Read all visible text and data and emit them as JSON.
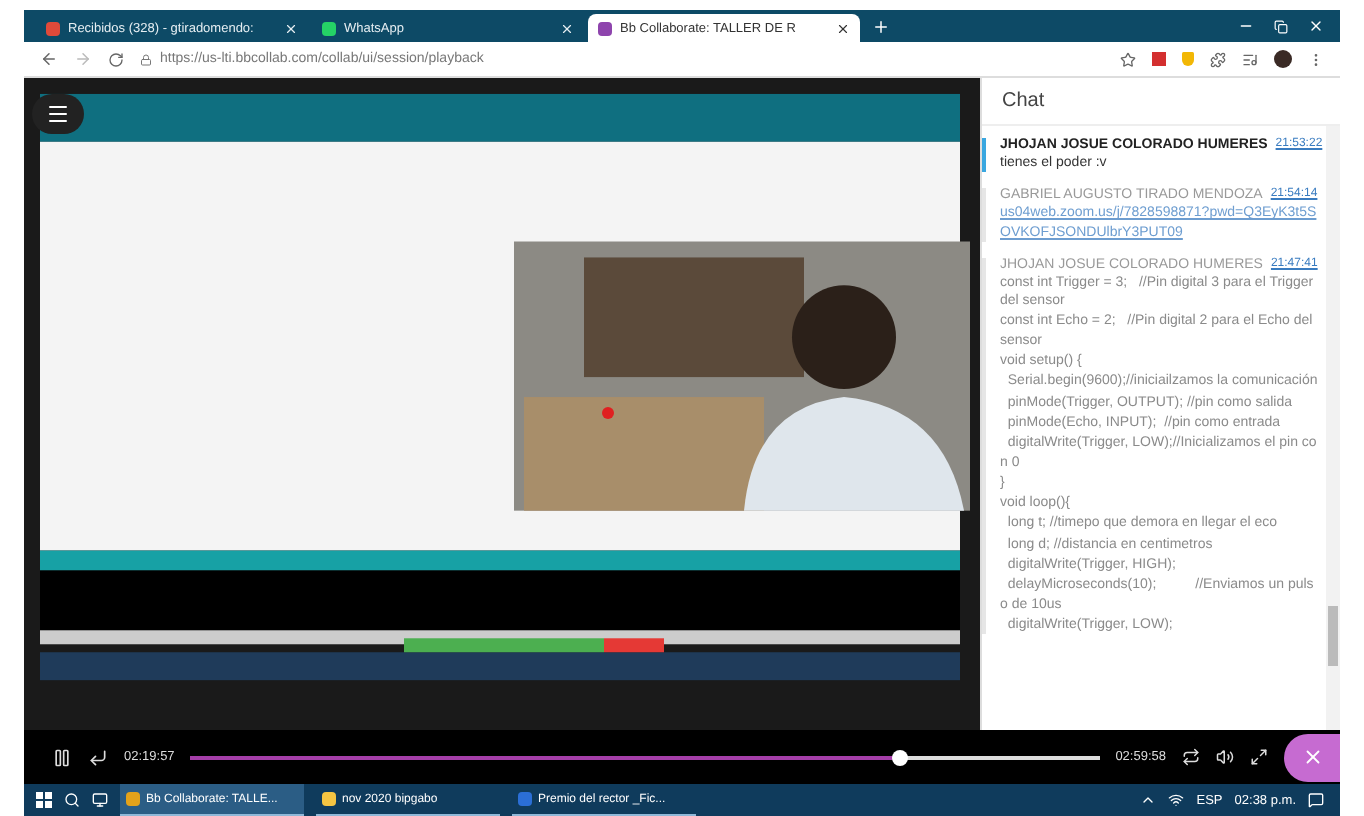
{
  "browser": {
    "tabs": [
      {
        "kind": "mail",
        "title": "Recibidos (328) - gtiradomendo:",
        "selected": false
      },
      {
        "kind": "whatsapp",
        "title": "WhatsApp",
        "selected": false
      },
      {
        "kind": "collab",
        "title": "Bb Collaborate: TALLER DE R",
        "selected": true
      }
    ],
    "address": "https://us-lti.bbcollab.com/collab/ui/session/playback"
  },
  "chat": {
    "title": "Chat",
    "messages": [
      {
        "author": "JHOJAN JOSUE COLORADO HUMERES",
        "time": "21:53:22",
        "highlighted": true,
        "kind": "text",
        "lines": [
          "tienes el poder :v"
        ]
      },
      {
        "author": "GABRIEL AUGUSTO TIRADO MENDOZA",
        "time": "21:54:14",
        "highlighted": false,
        "kind": "link",
        "lines": [
          "us04web.zoom.us/j/7828598871?pwd=Q3EyK3t5SOVKOFJSONDUlbrY3PUT09"
        ]
      },
      {
        "author": "JHOJAN JOSUE COLORADO HUMERES",
        "time": "21:47:41",
        "highlighted": false,
        "kind": "text",
        "lines": [
          "const int Trigger = 3;   //Pin digital 3 para el Trigger del sensor",
          "const int Echo = 2;   //Pin digital 2 para el Echo del sensor",
          "void setup() {",
          "  Serial.begin(9600);//iniciailzamos la comunicación",
          "  pinMode(Trigger, OUTPUT); //pin como salida",
          "  pinMode(Echo, INPUT);  //pin como entrada",
          "  digitalWrite(Trigger, LOW);//Inicializamos el pin con 0",
          "}",
          "void loop(){",
          "  long t; //timepo que demora en llegar el eco",
          "  long d; //distancia en centimetros",
          "  digitalWrite(Trigger, HIGH);",
          "  delayMicroseconds(10);          //Enviamos un pulso de 10us",
          "  digitalWrite(Trigger, LOW);"
        ]
      }
    ]
  },
  "player": {
    "elapsed": "02:19:57",
    "total": "02:59:58",
    "level": 0.78
  },
  "taskbar": {
    "items": [
      {
        "kind": "browser",
        "label": "Bb Collaborate: TALLE...",
        "selected": true
      },
      {
        "kind": "folder",
        "label": "nov 2020 bipgabo",
        "selected": false
      },
      {
        "kind": "word",
        "label": "Premio del rector _Fic...",
        "selected": false
      }
    ],
    "language": "ESP",
    "clock": "02:38 p.m."
  }
}
